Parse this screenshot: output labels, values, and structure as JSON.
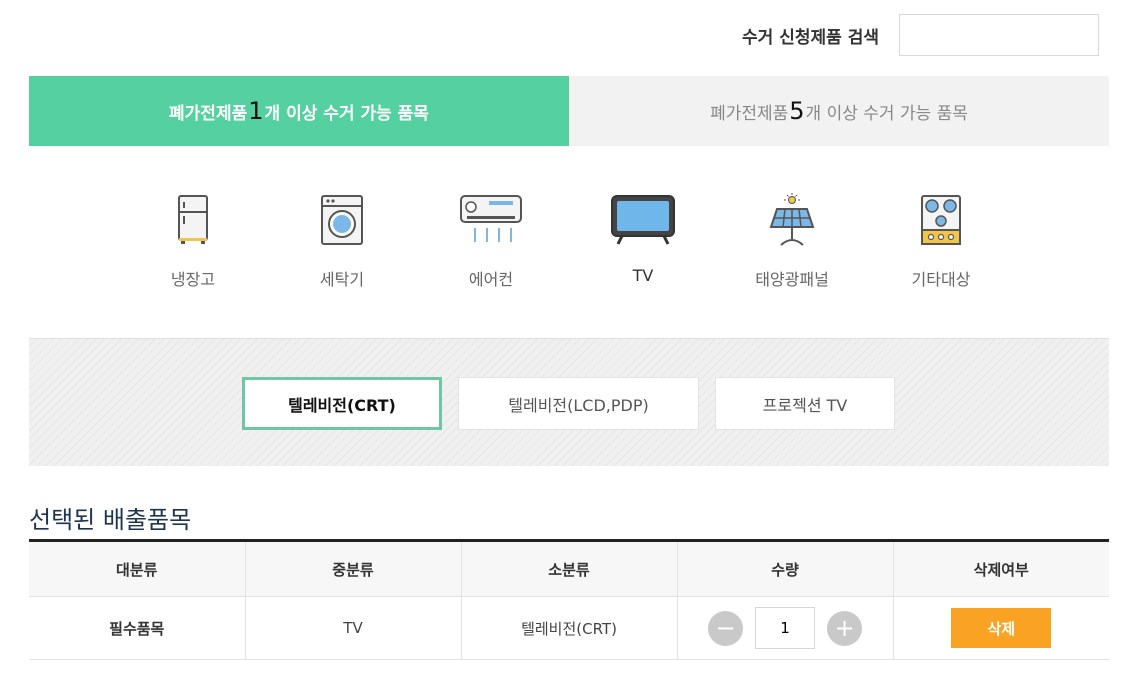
{
  "search": {
    "label": "수거 신청제품 검색",
    "value": "",
    "placeholder": ""
  },
  "tabs": [
    {
      "prefix": "폐가전제품 ",
      "count": "1",
      "suffix": "개 이상 수거 가능 품목",
      "active": true
    },
    {
      "prefix": "폐가전제품 ",
      "count": "5",
      "suffix": "개 이상 수거 가능 품목",
      "active": false
    }
  ],
  "categories": [
    {
      "label": "냉장고",
      "icon": "refrigerator-icon"
    },
    {
      "label": "세탁기",
      "icon": "washing-machine-icon"
    },
    {
      "label": "에어컨",
      "icon": "air-conditioner-icon"
    },
    {
      "label": "TV",
      "icon": "tv-icon",
      "selected": true
    },
    {
      "label": "태양광패널",
      "icon": "solar-panel-icon"
    },
    {
      "label": "기타대상",
      "icon": "stove-icon"
    }
  ],
  "subcategories": [
    {
      "label": "텔레비전(CRT)",
      "selected": true
    },
    {
      "label": "텔레비전(LCD,PDP)"
    },
    {
      "label": "프로젝션 TV"
    }
  ],
  "section_title": "선택된 배출품목",
  "table": {
    "headers": [
      "대분류",
      "중분류",
      "소분류",
      "수량",
      "삭제여부"
    ],
    "rows": [
      {
        "major": "필수품목",
        "middle": "TV",
        "minor": "텔레비전(CRT)",
        "quantity": "1",
        "delete_label": "삭제"
      }
    ]
  },
  "colors": {
    "accent": "#55d0a0",
    "delete": "#f9a224",
    "title": "#1d3550"
  }
}
